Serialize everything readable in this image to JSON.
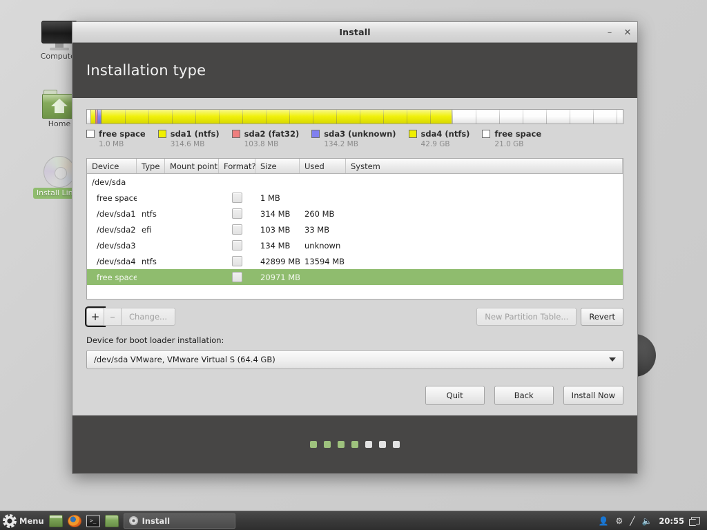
{
  "desktop": {
    "icons": [
      {
        "name": "Computer",
        "icon": "computer-icon",
        "selected": false
      },
      {
        "name": "Home",
        "icon": "home-folder-icon",
        "selected": false
      },
      {
        "name": "Install Linux",
        "icon": "install-disc-icon",
        "selected": true
      }
    ]
  },
  "window": {
    "title": "Install",
    "minimize_label": "–",
    "close_label": "✕",
    "heading": "Installation type"
  },
  "partition_bar": {
    "segments": [
      {
        "label": "free space",
        "size": "1.0 MB",
        "color": "#ffffff",
        "width_pct": 0.6
      },
      {
        "label": "sda1 (ntfs)",
        "size": "314.6 MB",
        "color": "#f0f000",
        "width_pct": 0.9
      },
      {
        "label": "sda2 (fat32)",
        "size": "103.8 MB",
        "color": "#ef7f7f",
        "width_pct": 0.5
      },
      {
        "label": "sda3 (unknown)",
        "size": "134.2 MB",
        "color": "#7f7fef",
        "width_pct": 0.6
      },
      {
        "label": "sda4 (ntfs)",
        "size": "42.9 GB",
        "color": "#f0f000",
        "width_pct": 65.4
      },
      {
        "label": "free space",
        "size": "21.0 GB",
        "color": "#fdfdfd",
        "width_pct": 32.0
      }
    ]
  },
  "legend": [
    {
      "swatch": "#ffffff",
      "name": "free space",
      "size": "1.0 MB"
    },
    {
      "swatch": "#f0f000",
      "name": "sda1 (ntfs)",
      "size": "314.6 MB"
    },
    {
      "swatch": "#ef7f7f",
      "name": "sda2 (fat32)",
      "size": "103.8 MB"
    },
    {
      "swatch": "#7f7fef",
      "name": "sda3 (unknown)",
      "size": "134.2 MB"
    },
    {
      "swatch": "#f0f000",
      "name": "sda4 (ntfs)",
      "size": "42.9 GB"
    },
    {
      "swatch": "#ffffff",
      "name": "free space",
      "size": "21.0 GB"
    }
  ],
  "table": {
    "columns": [
      "Device",
      "Type",
      "Mount point",
      "Format?",
      "Size",
      "Used",
      "System"
    ],
    "rows": [
      {
        "device": "/dev/sda",
        "type": "",
        "mount": "",
        "format": false,
        "size": "",
        "used": "",
        "system": "",
        "indent": false,
        "selected": false,
        "has_checkbox": false
      },
      {
        "device": "free space",
        "type": "",
        "mount": "",
        "format": false,
        "size": "1 MB",
        "used": "",
        "system": "",
        "indent": true,
        "selected": false,
        "has_checkbox": true
      },
      {
        "device": "/dev/sda1",
        "type": "ntfs",
        "mount": "",
        "format": false,
        "size": "314 MB",
        "used": "260 MB",
        "system": "",
        "indent": true,
        "selected": false,
        "has_checkbox": true
      },
      {
        "device": "/dev/sda2",
        "type": "efi",
        "mount": "",
        "format": false,
        "size": "103 MB",
        "used": "33 MB",
        "system": "",
        "indent": true,
        "selected": false,
        "has_checkbox": true
      },
      {
        "device": "/dev/sda3",
        "type": "",
        "mount": "",
        "format": false,
        "size": "134 MB",
        "used": "unknown",
        "system": "",
        "indent": true,
        "selected": false,
        "has_checkbox": true
      },
      {
        "device": "/dev/sda4",
        "type": "ntfs",
        "mount": "",
        "format": false,
        "size": "42899 MB",
        "used": "13594 MB",
        "system": "",
        "indent": true,
        "selected": false,
        "has_checkbox": true
      },
      {
        "device": "free space",
        "type": "",
        "mount": "",
        "format": false,
        "size": "20971 MB",
        "used": "",
        "system": "",
        "indent": true,
        "selected": true,
        "has_checkbox": true
      }
    ]
  },
  "toolbar": {
    "add_label": "+",
    "remove_label": "–",
    "change_label": "Change...",
    "new_partition_table_label": "New Partition Table...",
    "revert_label": "Revert"
  },
  "bootloader": {
    "label": "Device for boot loader installation:",
    "selected": "/dev/sda   VMware, VMware Virtual S (64.4 GB)"
  },
  "footer": {
    "quit_label": "Quit",
    "back_label": "Back",
    "install_label": "Install Now",
    "progress_dots": [
      "on",
      "on",
      "on",
      "on",
      "off",
      "off",
      "off"
    ]
  },
  "taskbar": {
    "menu_label": "Menu",
    "launchers": [
      "show-desktop-icon",
      "firefox-icon",
      "terminal-icon",
      "file-manager-icon"
    ],
    "task_label": "Install",
    "tray_icons": [
      "user-icon",
      "bluetooth-icon",
      "network-icon",
      "volume-icon"
    ],
    "clock": "20:55"
  }
}
